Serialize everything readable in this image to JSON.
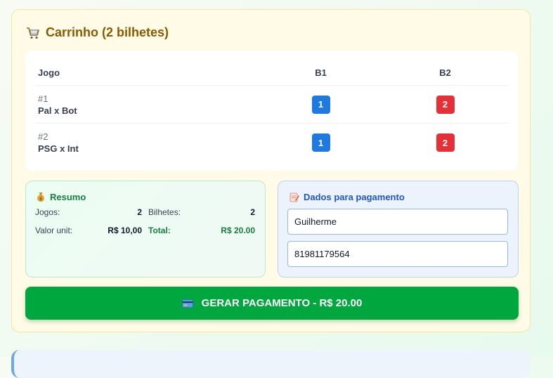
{
  "cart": {
    "title": "Carrinho (2 bilhetes)",
    "icon": "shopping-cart-icon"
  },
  "table": {
    "headers": {
      "game": "Jogo",
      "b1": "B1",
      "b2": "B2"
    },
    "rows": [
      {
        "num": "#1",
        "name": "Pal x Bot",
        "b1": "1",
        "b2": "2"
      },
      {
        "num": "#2",
        "name": "PSG x Int",
        "b1": "1",
        "b2": "2"
      }
    ]
  },
  "summary": {
    "title": "Resumo",
    "icon": "money-bag-icon",
    "games_label": "Jogos:",
    "games_value": "2",
    "tickets_label": "Bilhetes:",
    "tickets_value": "2",
    "unit_label": "Valor unit:",
    "unit_value": "R$ 10,00",
    "total_label": "Total:",
    "total_value": "R$ 20.00"
  },
  "payment": {
    "title": "Dados para pagamento",
    "icon": "memo-icon",
    "name_value": "Guilherme",
    "phone_value": "81981179564"
  },
  "pay_button": {
    "label": "GERAR PAGAMENTO - R$ 20.00",
    "icon": "credit-card-icon"
  },
  "colors": {
    "blue_badge": "#1f7ae0",
    "red_badge": "#e63038",
    "pay_button": "#00a63e"
  }
}
